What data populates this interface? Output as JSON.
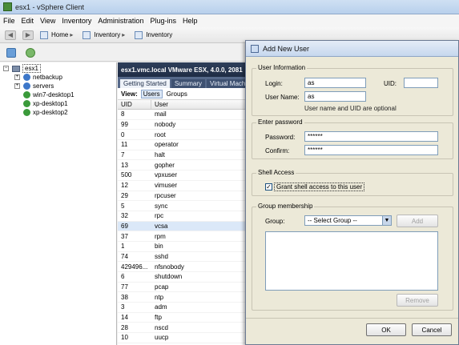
{
  "window": {
    "title": "esx1 - vSphere Client"
  },
  "menu": [
    "File",
    "Edit",
    "View",
    "Inventory",
    "Administration",
    "Plug-ins",
    "Help"
  ],
  "breadcrumb": [
    "Home",
    "Inventory",
    "Inventory"
  ],
  "tree": {
    "host": "esx1",
    "items": [
      {
        "label": "netbackup",
        "expandable": true
      },
      {
        "label": "servers",
        "expandable": true
      },
      {
        "label": "win7-desktop1",
        "expandable": false
      },
      {
        "label": "xp-desktop1",
        "expandable": false
      },
      {
        "label": "xp-desktop2",
        "expandable": false
      }
    ]
  },
  "host_panel": {
    "header": "esx1.vmc.local VMware ESX, 4.0.0, 2081",
    "tabs": [
      "Getting Started",
      "Summary",
      "Virtual Mach"
    ],
    "view_label": "View:",
    "view_buttons": [
      "Users",
      "Groups"
    ],
    "columns": [
      "UID",
      "User"
    ],
    "rows": [
      [
        "8",
        "mail"
      ],
      [
        "99",
        "nobody"
      ],
      [
        "0",
        "root"
      ],
      [
        "11",
        "operator"
      ],
      [
        "7",
        "halt"
      ],
      [
        "13",
        "gopher"
      ],
      [
        "500",
        "vpxuser"
      ],
      [
        "12",
        "vimuser"
      ],
      [
        "29",
        "rpcuser"
      ],
      [
        "5",
        "sync"
      ],
      [
        "32",
        "rpc"
      ],
      [
        "69",
        "vcsa"
      ],
      [
        "37",
        "rpm"
      ],
      [
        "1",
        "bin"
      ],
      [
        "74",
        "sshd"
      ],
      [
        "429496...",
        "nfsnobody"
      ],
      [
        "6",
        "shutdown"
      ],
      [
        "77",
        "pcap"
      ],
      [
        "38",
        "ntp"
      ],
      [
        "3",
        "adm"
      ],
      [
        "14",
        "ftp"
      ],
      [
        "28",
        "nscd"
      ],
      [
        "10",
        "uucp"
      ]
    ]
  },
  "dialog": {
    "title": "Add New User",
    "user_info": {
      "legend": "User Information",
      "login_label": "Login:",
      "login_value": "as",
      "uid_label": "UID:",
      "uid_value": "",
      "username_label": "User Name:",
      "username_value": "as",
      "note": "User name and UID are optional"
    },
    "password": {
      "legend": "Enter password",
      "password_label": "Password:",
      "password_value": "******",
      "confirm_label": "Confirm:",
      "confirm_value": "******"
    },
    "shell": {
      "legend": "Shell Access",
      "checkbox_label": "Grant shell access to this user",
      "checked": true
    },
    "groups": {
      "legend": "Group membership",
      "group_label": "Group:",
      "select_value": "-- Select Group --",
      "add_label": "Add",
      "remove_label": "Remove"
    },
    "ok_label": "OK",
    "cancel_label": "Cancel"
  }
}
